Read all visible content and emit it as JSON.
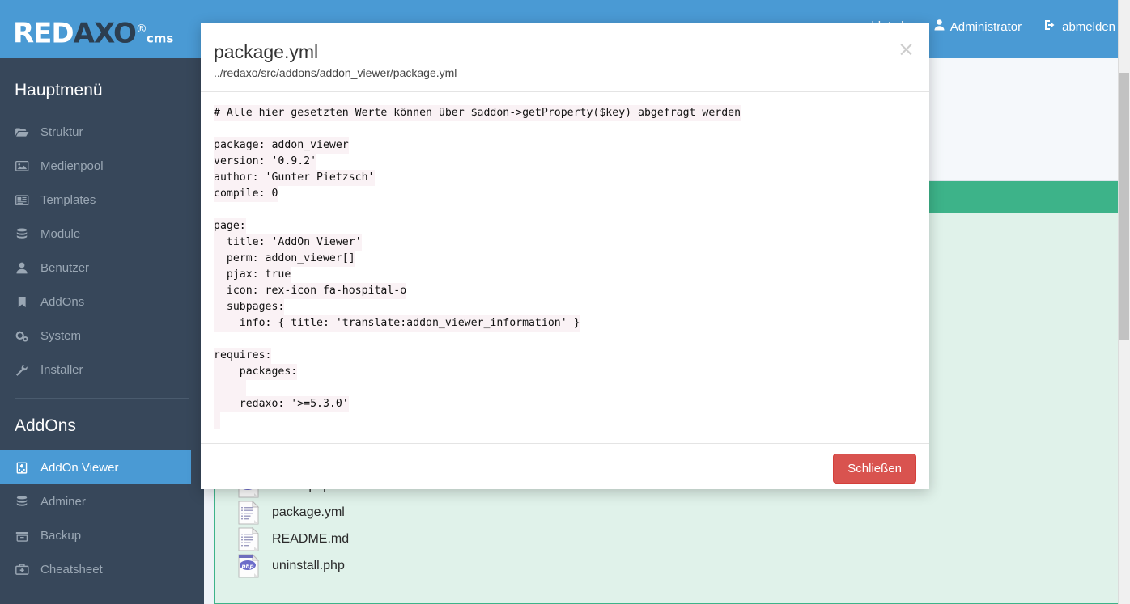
{
  "brand": {
    "part1": "RED",
    "part2": "AXO",
    "reg": "®",
    "cms": "cms"
  },
  "topbar": {
    "obscured_text": "angemeldet als",
    "user_label": "Administrator",
    "logout_label": "abmelden"
  },
  "sidebar": {
    "main_title": "Hauptmenü",
    "main_items": [
      {
        "label": "Struktur",
        "icon": "folder-open-icon"
      },
      {
        "label": "Medienpool",
        "icon": "image-icon"
      },
      {
        "label": "Templates",
        "icon": "newspaper-icon"
      },
      {
        "label": "Module",
        "icon": "database-icon"
      },
      {
        "label": "Benutzer",
        "icon": "user-icon"
      },
      {
        "label": "AddOns",
        "icon": "bookmark-icon"
      },
      {
        "label": "System",
        "icon": "gears-icon"
      },
      {
        "label": "Installer",
        "icon": "wrench-icon"
      }
    ],
    "addons_title": "AddOns",
    "addon_items": [
      {
        "label": "AddOn Viewer",
        "icon": "hospital-icon",
        "active": true
      },
      {
        "label": "Adminer",
        "icon": "database-icon",
        "active": false
      },
      {
        "label": "Backup",
        "icon": "archive-icon",
        "active": false
      },
      {
        "label": "Cheatsheet",
        "icon": "medkit-icon",
        "active": false
      }
    ]
  },
  "filelist": {
    "items": [
      {
        "name": "install.php",
        "icon": "php-file-icon"
      },
      {
        "name": "package.yml",
        "icon": "text-file-icon"
      },
      {
        "name": "README.md",
        "icon": "text-file-icon"
      },
      {
        "name": "uninstall.php",
        "icon": "php-file-icon"
      }
    ]
  },
  "modal": {
    "title": "package.yml",
    "subtitle": "../redaxo/src/addons/addon_viewer/package.yml",
    "close_icon": "close-icon",
    "close_button_label": "Schließen",
    "code_lines": [
      "# Alle hier gesetzten Werte können über $addon->getProperty($key) abgefragt werden",
      "",
      "package: addon_viewer",
      "version: '0.9.2'",
      "author: 'Gunter Pietzsch'",
      "compile: 0",
      "",
      "page:",
      "  title: 'AddOn Viewer'",
      "  perm: addon_viewer[]",
      "  pjax: true",
      "  icon: rex-icon fa-hospital-o",
      "  subpages:",
      "    info: { title: 'translate:addon_viewer_information' }",
      "",
      "requires:",
      "    packages:",
      "     ",
      "    redaxo: '>=5.3.0'",
      " "
    ]
  },
  "colors": {
    "header_blue": "#4a9ad4",
    "sidebar_dark": "#37475a",
    "accent_green": "#3db389",
    "panel_green_bg": "#e0f2ea",
    "danger_red": "#d9534f",
    "page_bg": "#eff3f8"
  }
}
